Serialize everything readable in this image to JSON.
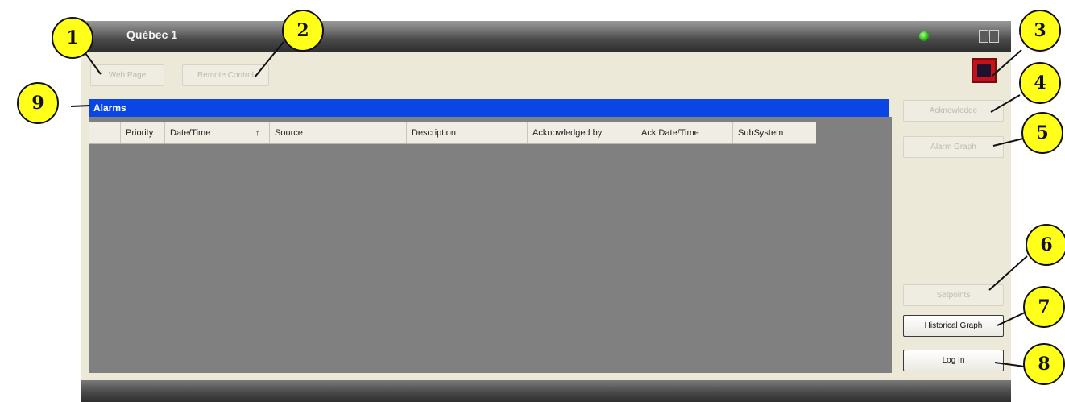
{
  "window": {
    "title": "Québec 1"
  },
  "toolbar": {
    "web_page": "Web Page",
    "remote_control": "Remote Control"
  },
  "alarms": {
    "header": "Alarms",
    "columns": [
      "Priority",
      "Date/Time",
      "Source",
      "Description",
      "Acknowledged by",
      "Ack Date/Time",
      "SubSystem"
    ],
    "sort_indicator": "↑"
  },
  "side_buttons": {
    "acknowledge": "Acknowledge",
    "alarm_graph": "Alarm Graph",
    "setpoints": "Setpoints",
    "historical_graph": "Historical Graph",
    "log_in": "Log In"
  },
  "callouts": [
    "1",
    "2",
    "3",
    "4",
    "5",
    "6",
    "7",
    "8",
    "9"
  ],
  "colors": {
    "accent": "#0a46e6",
    "callout_fill": "#ffff19",
    "status_led": "#1fb80a",
    "app_icon": "#c3121a"
  },
  "icons": {
    "status": "green-status-led-icon",
    "app": "application-logo-icon"
  }
}
